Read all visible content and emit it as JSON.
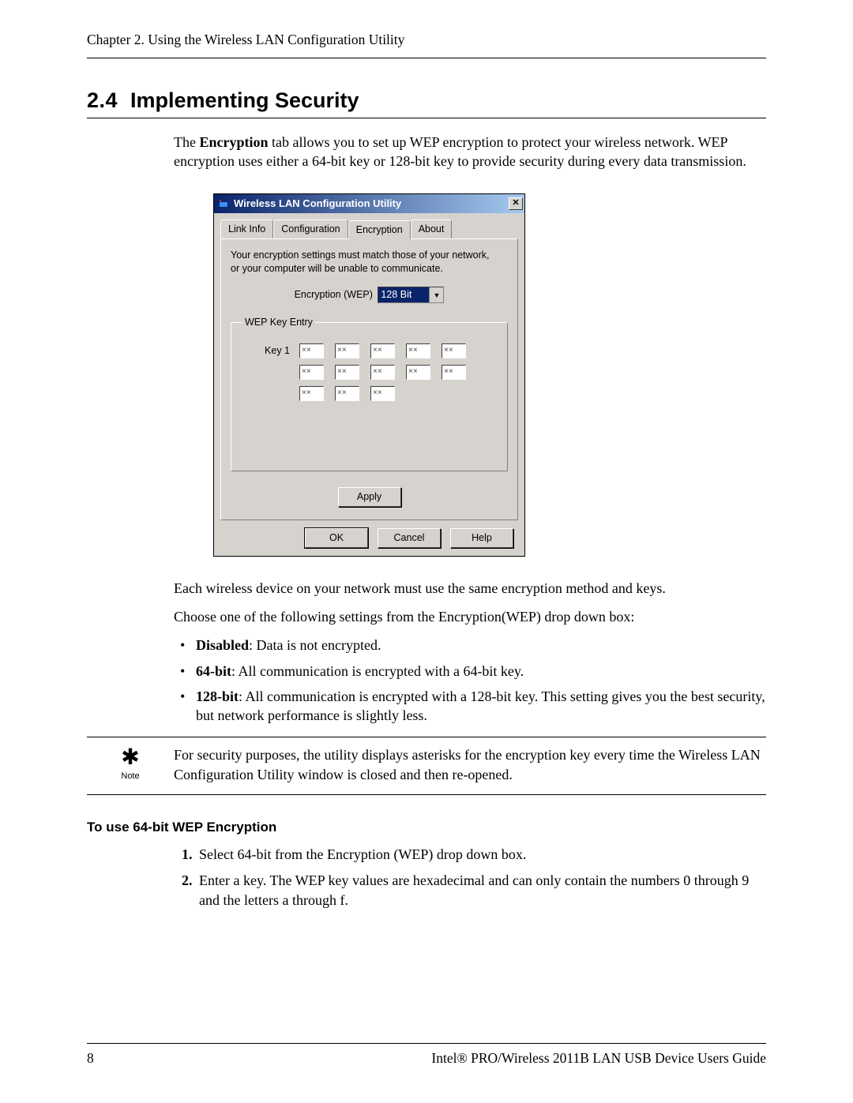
{
  "header": {
    "running": "Chapter 2. Using the Wireless LAN Configuration Utility"
  },
  "section": {
    "number": "2.4",
    "title": "Implementing Security"
  },
  "intro": {
    "prefix": "The ",
    "bold": "Encryption",
    "suffix": " tab allows you to set up WEP encryption to protect your wireless network. WEP encryption uses either a 64-bit key or 128-bit key to provide security during every data transmission."
  },
  "dialog": {
    "title": "Wireless LAN Configuration Utility",
    "close_glyph": "✕",
    "tabs": [
      "Link Info",
      "Configuration",
      "Encryption",
      "About"
    ],
    "active_tab_index": 2,
    "info_line1": "Your encryption settings must match those of your network,",
    "info_line2": "or your computer will be unable to communicate.",
    "enc_label": "Encryption (WEP)",
    "enc_value": "128 Bit",
    "group_legend": "WEP Key Entry",
    "key_label": "Key 1",
    "cell_placeholder": "××",
    "apply": "Apply",
    "ok": "OK",
    "cancel": "Cancel",
    "help": "Help"
  },
  "after1": "Each wireless device on your network must use the same encryption method and keys.",
  "after2": "Choose one of the following settings from the Encryption(WEP) drop down box:",
  "options": [
    {
      "bold": "Disabled",
      "rest": ": Data is not encrypted."
    },
    {
      "bold": "64-bit",
      "rest": ": All communication is encrypted with a 64-bit key."
    },
    {
      "bold": "128-bit",
      "rest": ": All communication is encrypted with a 128-bit key. This setting gives you the best security, but network performance is slightly less."
    }
  ],
  "note": {
    "label": "Note",
    "glyph": "✱",
    "text": "For security purposes, the utility displays asterisks for the encryption key every time the Wireless LAN Configuration Utility window is closed and then re-opened."
  },
  "subsection": {
    "title": "To use 64-bit WEP Encryption"
  },
  "steps": [
    "Select 64-bit from the Encryption (WEP) drop down box.",
    "Enter a key. The WEP key values are hexadecimal and can only contain the numbers 0 through 9 and the letters a through f."
  ],
  "footer": {
    "page": "8",
    "guide": "Intel® PRO/Wireless 2011B LAN USB Device Users Guide"
  }
}
